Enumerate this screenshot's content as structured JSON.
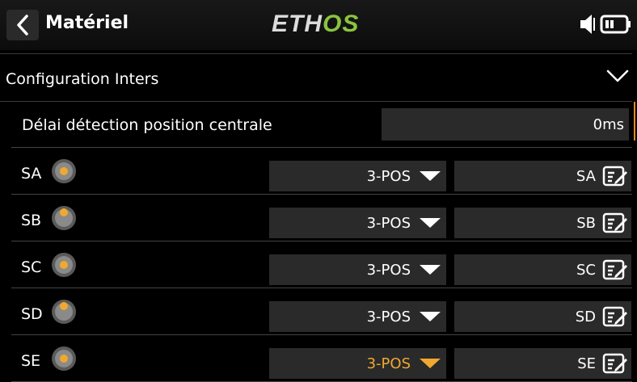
{
  "header": {
    "title": "Matériel",
    "brand_left": "ETH",
    "brand_right": "OS"
  },
  "icons": {
    "back": "chevron-left-icon",
    "speaker": "speaker-icon",
    "battery": "battery-icon",
    "collapse": "chevron-down-icon",
    "switch": "switch-position-icon",
    "dropdown": "triangle-down-icon",
    "edit": "edit-icon"
  },
  "section": {
    "title": "Configuration Inters"
  },
  "delay": {
    "label": "Délai détection position centrale",
    "value": "0ms"
  },
  "switches": [
    {
      "label": "SA",
      "type": "3-POS",
      "name": "SA",
      "position": "center",
      "active": false
    },
    {
      "label": "SB",
      "type": "3-POS",
      "name": "SB",
      "position": "up",
      "active": false
    },
    {
      "label": "SC",
      "type": "3-POS",
      "name": "SC",
      "position": "center",
      "active": false
    },
    {
      "label": "SD",
      "type": "3-POS",
      "name": "SD",
      "position": "up",
      "active": false
    },
    {
      "label": "SE",
      "type": "3-POS",
      "name": "SE",
      "position": "center",
      "active": true
    }
  ],
  "colors": {
    "accent": "#f0a830",
    "brand_green": "#8ac43f",
    "field_bg": "#2a2a2a",
    "background": "#000000"
  }
}
